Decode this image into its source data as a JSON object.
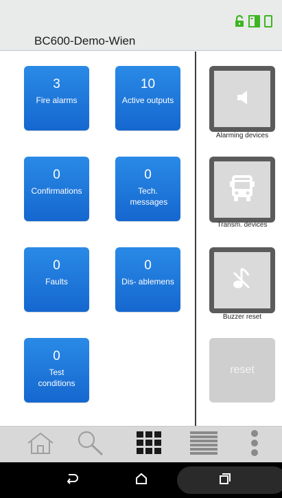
{
  "header": {
    "title": "BC600-Demo-Wien",
    "status_icons": [
      "unlock-icon",
      "panel-icon",
      "device-icon"
    ],
    "accent_color": "#3cb521"
  },
  "tiles": [
    {
      "value": "3",
      "label": "Fire alarms"
    },
    {
      "value": "10",
      "label": "Active outputs"
    },
    {
      "value": "0",
      "label": "Confirmations"
    },
    {
      "value": "0",
      "label": "Tech. messages"
    },
    {
      "value": "0",
      "label": "Faults"
    },
    {
      "value": "0",
      "label": "Dis- ablemens"
    },
    {
      "value": "0",
      "label": "Test conditions"
    }
  ],
  "side_buttons": [
    {
      "icon": "speaker-icon",
      "caption": "Alarming devices"
    },
    {
      "icon": "bus-icon",
      "caption": "Transm. devices"
    },
    {
      "icon": "buzzer-mute-icon",
      "caption": "Buzzer reset"
    }
  ],
  "reset": {
    "label": "reset"
  },
  "bottom_nav": [
    "home-icon",
    "search-icon",
    "grid-icon",
    "list-icon",
    "more-icon"
  ],
  "system_nav": [
    "back-icon",
    "home-icon",
    "recents-icon"
  ],
  "colors": {
    "tile": "#1f78dc",
    "side_button_frame": "#5b5b5b",
    "reset_disabled": "#cfcfcf"
  }
}
